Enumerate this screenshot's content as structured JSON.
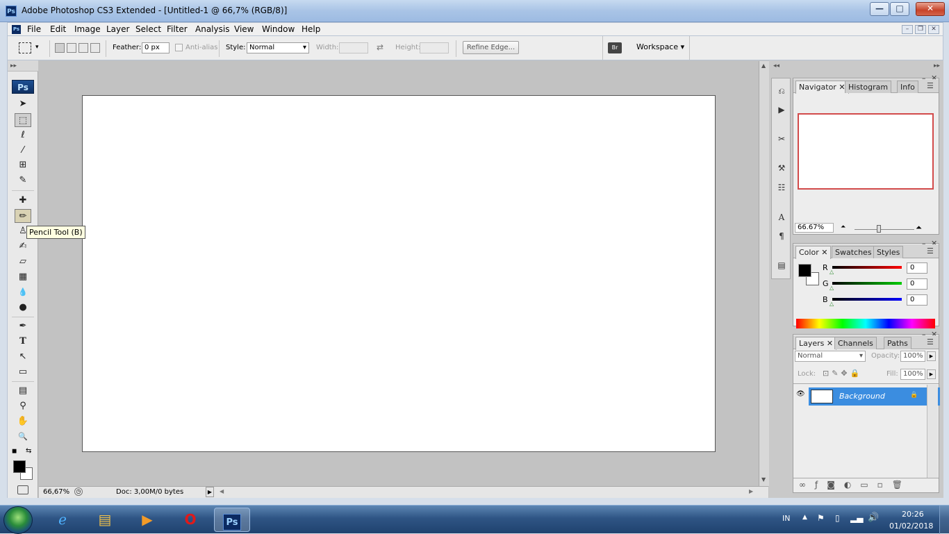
{
  "window": {
    "title": "Adobe Photoshop CS3 Extended - [Untitled-1 @ 66,7% (RGB/8)]",
    "app_icon": "Ps",
    "min_label": "—",
    "max_label": "□",
    "close_label": "✕"
  },
  "menu": {
    "items": [
      "File",
      "Edit",
      "Image",
      "Layer",
      "Select",
      "Filter",
      "Analysis",
      "View",
      "Window",
      "Help"
    ],
    "doc_min": "–",
    "doc_restore": "❐",
    "doc_close": "✕"
  },
  "options": {
    "feather_label": "Feather:",
    "feather_value": "0 px",
    "antialias_label": "Anti-alias",
    "style_label": "Style:",
    "style_value": "Normal",
    "width_label": "Width:",
    "height_label": "Height:",
    "refine_edge": "Refine Edge...",
    "workspace": "Workspace ▾"
  },
  "toolbox": {
    "logo": "Ps",
    "collapse": "▸▸",
    "tooltip": "Pencil Tool (B)",
    "tools": [
      {
        "name": "move-tool-icon",
        "glyph": "➤"
      },
      {
        "name": "marquee-tool-icon",
        "glyph": "⬚",
        "selected": true
      },
      {
        "name": "lasso-tool-icon",
        "glyph": "ℓ"
      },
      {
        "name": "magic-wand-tool-icon",
        "glyph": "⁄"
      },
      {
        "name": "crop-tool-icon",
        "glyph": "⊞"
      },
      {
        "name": "slice-tool-icon",
        "glyph": "✎"
      },
      {
        "name": "healing-brush-tool-icon",
        "glyph": "✚"
      },
      {
        "name": "pencil-tool-icon",
        "glyph": "✏",
        "selected": true
      },
      {
        "name": "clone-stamp-tool-icon",
        "glyph": "♙"
      },
      {
        "name": "history-brush-tool-icon",
        "glyph": "✍"
      },
      {
        "name": "eraser-tool-icon",
        "glyph": "▱"
      },
      {
        "name": "gradient-tool-icon",
        "glyph": "▦"
      },
      {
        "name": "blur-tool-icon",
        "glyph": "💧"
      },
      {
        "name": "dodge-tool-icon",
        "glyph": "●"
      },
      {
        "name": "pen-tool-icon",
        "glyph": "✒"
      },
      {
        "name": "type-tool-icon",
        "glyph": "T"
      },
      {
        "name": "path-selection-tool-icon",
        "glyph": "↖"
      },
      {
        "name": "shape-tool-icon",
        "glyph": "▭"
      },
      {
        "name": "notes-tool-icon",
        "glyph": "▤"
      },
      {
        "name": "eyedropper-tool-icon",
        "glyph": "⚲"
      },
      {
        "name": "hand-tool-icon",
        "glyph": "✋"
      },
      {
        "name": "zoom-tool-icon",
        "glyph": "🔍"
      }
    ]
  },
  "status": {
    "zoom": "66,67%",
    "doc": "Doc: 3,00M/0 bytes"
  },
  "navigator": {
    "tabs": [
      "Navigator",
      "Histogram",
      "Info"
    ],
    "zoom": "66.67%"
  },
  "color": {
    "tabs": [
      "Color",
      "Swatches",
      "Styles"
    ],
    "r_label": "R",
    "g_label": "G",
    "b_label": "B",
    "r": "0",
    "g": "0",
    "b": "0"
  },
  "layers": {
    "tabs": [
      "Layers",
      "Channels",
      "Paths"
    ],
    "blend_mode": "Normal",
    "opacity_label": "Opacity:",
    "opacity": "100%",
    "lock_label": "Lock:",
    "fill_label": "Fill:",
    "fill": "100%",
    "layer_name": "Background"
  },
  "taskbar": {
    "lang": "IN",
    "time": "20:26",
    "date": "01/02/2018",
    "ps_label": "Ps"
  }
}
